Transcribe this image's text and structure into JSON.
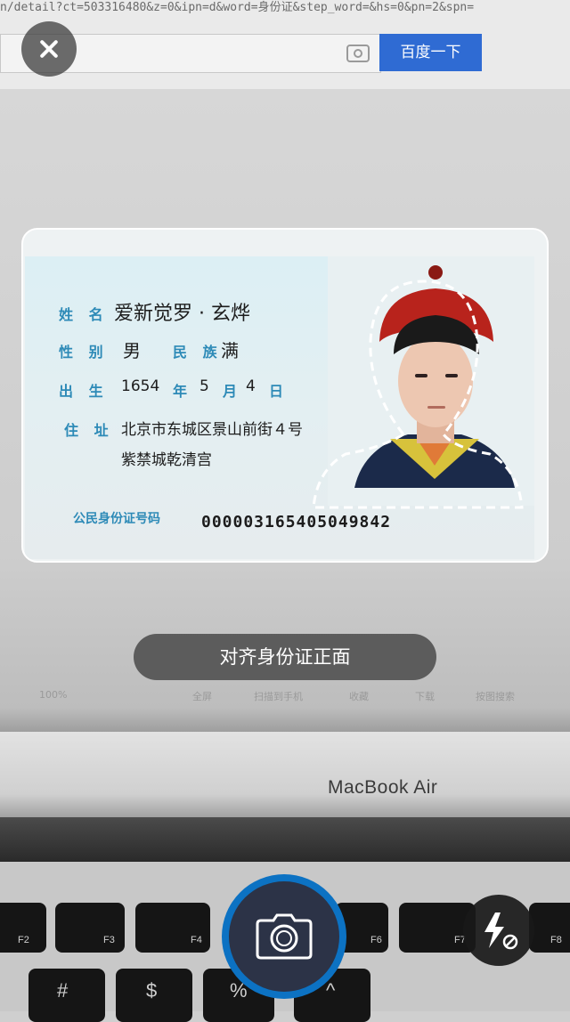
{
  "background": {
    "browser_url": "n/detail?ct=503316480&z=0&ipn=d&word=身份证&step_word=&hs=0&pn=2&spn=",
    "search_button_label": "百度一下",
    "toolbar_items": [
      "100%",
      "全屏",
      "扫描到手机",
      "收藏",
      "下载",
      "按图搜索"
    ],
    "laptop_label": "MacBook Air",
    "keys": {
      "f2": "F2",
      "f3": "F3",
      "f4": "F4",
      "f6": "F6",
      "f7": "F7",
      "f8": "F8",
      "hash": "#",
      "dollar": "$",
      "percent": "%",
      "caret": "^"
    }
  },
  "id_card": {
    "name_label": "姓 名",
    "name_value": "爱新觉罗 · 玄烨",
    "gender_label": "性 别",
    "gender_value": "男",
    "ethnicity_label": "民 族",
    "ethnicity_value": "满",
    "birth_label": "出 生",
    "birth_year": "1654",
    "year_unit": "年",
    "birth_month": "5",
    "month_unit": "月",
    "birth_day": "4",
    "day_unit": "日",
    "address_label": "住 址",
    "address_line1": "北京市东城区景山前街４号",
    "address_line2": "紫禁城乾清宫",
    "id_label": "公民身份证号码",
    "id_number": "000003165405049842"
  },
  "camera": {
    "hint_text": "对齐身份证正面",
    "accent_color": "#0c72c3",
    "icons": [
      "close-icon",
      "camera-icon",
      "flash-off-icon"
    ]
  }
}
